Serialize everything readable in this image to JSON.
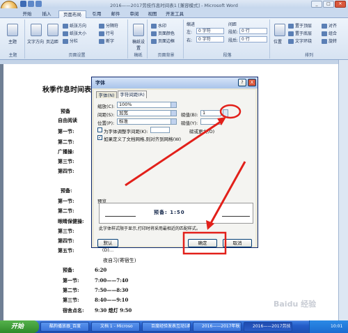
{
  "window": {
    "title": "2016——2017劳技作息时间表1 [兼容模式] - Microsoft Word"
  },
  "ribbon_tabs": [
    "开始",
    "插入",
    "页面布局",
    "引用",
    "邮件",
    "审阅",
    "视图",
    "开发工具"
  ],
  "ribbon": {
    "theme_label": "主题",
    "theme_group": "主题",
    "text_dir": "文字方向",
    "margins": "页边距",
    "orientation": "纸张方向",
    "size": "纸张大小",
    "columns": "分栏",
    "breaks": "分隔符",
    "line_numbers": "行号",
    "hyphen": "断字",
    "page_setup_group": "页面设置",
    "draft": "稿纸设置",
    "draft_group": "稿纸",
    "watermark": "水印",
    "page_color": "页面颜色",
    "page_border": "页面边框",
    "page_bg_group": "页面背景",
    "indent": "缩进",
    "spacing": "间距",
    "left_label": "左:",
    "left_val": "0 字符",
    "right_label": "右:",
    "right_val": "0 字符",
    "before_label": "段前:",
    "before_val": "0 行",
    "after_label": "段后:",
    "after_val": "0 行",
    "para_group": "段落",
    "position": "位置",
    "bring_front": "置于顶层",
    "send_back": "置于底层",
    "text_wrap": "文字环绕",
    "align": "对齐",
    "group": "组合",
    "rotate": "旋转",
    "arrange_group": "排列"
  },
  "document": {
    "title": "秋季作息时间表",
    "lines": [
      "预备",
      "自由阅读",
      "第一节:",
      "第二节:",
      "广播操:",
      "第三节:",
      "第四节:",
      "预备:",
      "第一节:",
      "第二节:",
      "眼睛保健操:",
      "第三节:",
      "第四节:",
      "第五节:"
    ],
    "section2_title": "夜自习(寄宿生)",
    "rows": [
      {
        "label": "预备:",
        "time": "6:20"
      },
      {
        "label": "第一节:",
        "time": "7:00——7:40"
      },
      {
        "label": "第二节:",
        "time": "7:50——8:30"
      },
      {
        "label": "第三节:",
        "time": "8:40——9:10"
      },
      {
        "label": "宿舍点名:",
        "time": "9:30    熄灯 9:50"
      }
    ]
  },
  "dialog": {
    "title": "字体",
    "help": "?",
    "close": "X",
    "tabs": [
      "字体(N)",
      "字符间距(R)"
    ],
    "scale_label": "缩放(C):",
    "scale_value": "100%",
    "spacing_label": "间距(S):",
    "spacing_value": "加宽",
    "spacing_amount_label": "磅值(B):",
    "spacing_amount_value": "1",
    "position_label": "位置(P):",
    "position_value": "标准",
    "position_amount_label": "磅值(Y):",
    "kerning_label": "为字体调整字间距(K):",
    "kerning_unit": "磅或更大(O)",
    "grid_label": "如果定义了文档网格,则对齐到网格(W)",
    "preview_title": "预览",
    "preview_text": "预备:    1:50",
    "preview_note": "此字体样式限于显示,打印时将采用最相近的匹配样式。",
    "default_btn": "默认(D)...",
    "ok_btn": "确定",
    "cancel_btn": "取消"
  },
  "taskbar": {
    "start": "开始",
    "tasks": [
      "酷狗播放器_百度",
      "文档 1 - Microso",
      "百度经验发表互动1群",
      "2016——2017年秋",
      "2016——2017劳技"
    ],
    "clock": "10:01"
  },
  "watermark": "Baidu 经验",
  "colors": {
    "annotation_red": "#e2201a",
    "title_blue": "#15284b",
    "taskbar_blue": "#245cc7"
  }
}
